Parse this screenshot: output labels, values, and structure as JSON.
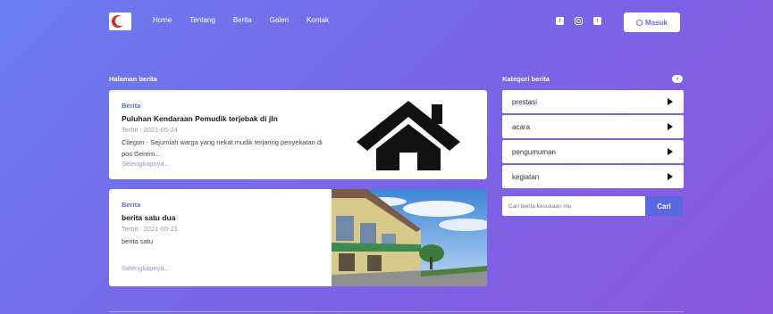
{
  "nav": {
    "links": [
      "Home",
      "Tentang",
      "Berita",
      "Galeri",
      "Kontak"
    ],
    "login_label": "Masuk",
    "social_icons": [
      "facebook-icon",
      "instagram-icon",
      "twitter-icon"
    ]
  },
  "news": {
    "heading": "Halaman berita",
    "cards": [
      {
        "category": "Berita",
        "title": "Puluhan Kendaraan Pemudik terjebak di jln",
        "date": "Terbit : 2021-05-24",
        "excerpt": "Cilegon - Sejumlah warga yang nekat mudik terjaring penyekatan di pos Gerem...",
        "more": "Selengkapnya...",
        "image": "house-icon"
      },
      {
        "category": "Berita",
        "title": "berita satu dua",
        "date": "Terbit : 2021-05-21",
        "excerpt": "berita satu",
        "more": "Selengkapnya...",
        "image": "building-photo"
      }
    ]
  },
  "sidebar": {
    "heading": "Kategori berita",
    "count": "4",
    "categories": [
      "prestasi",
      "acara",
      "pengumuman",
      "kegiatan"
    ],
    "search_placeholder": "Cari berita kesukaan mu",
    "search_button": "Cari"
  },
  "colors": {
    "accent": "#5a68e0",
    "background_start": "#6a7cf0",
    "background_end": "#8a58e0"
  }
}
